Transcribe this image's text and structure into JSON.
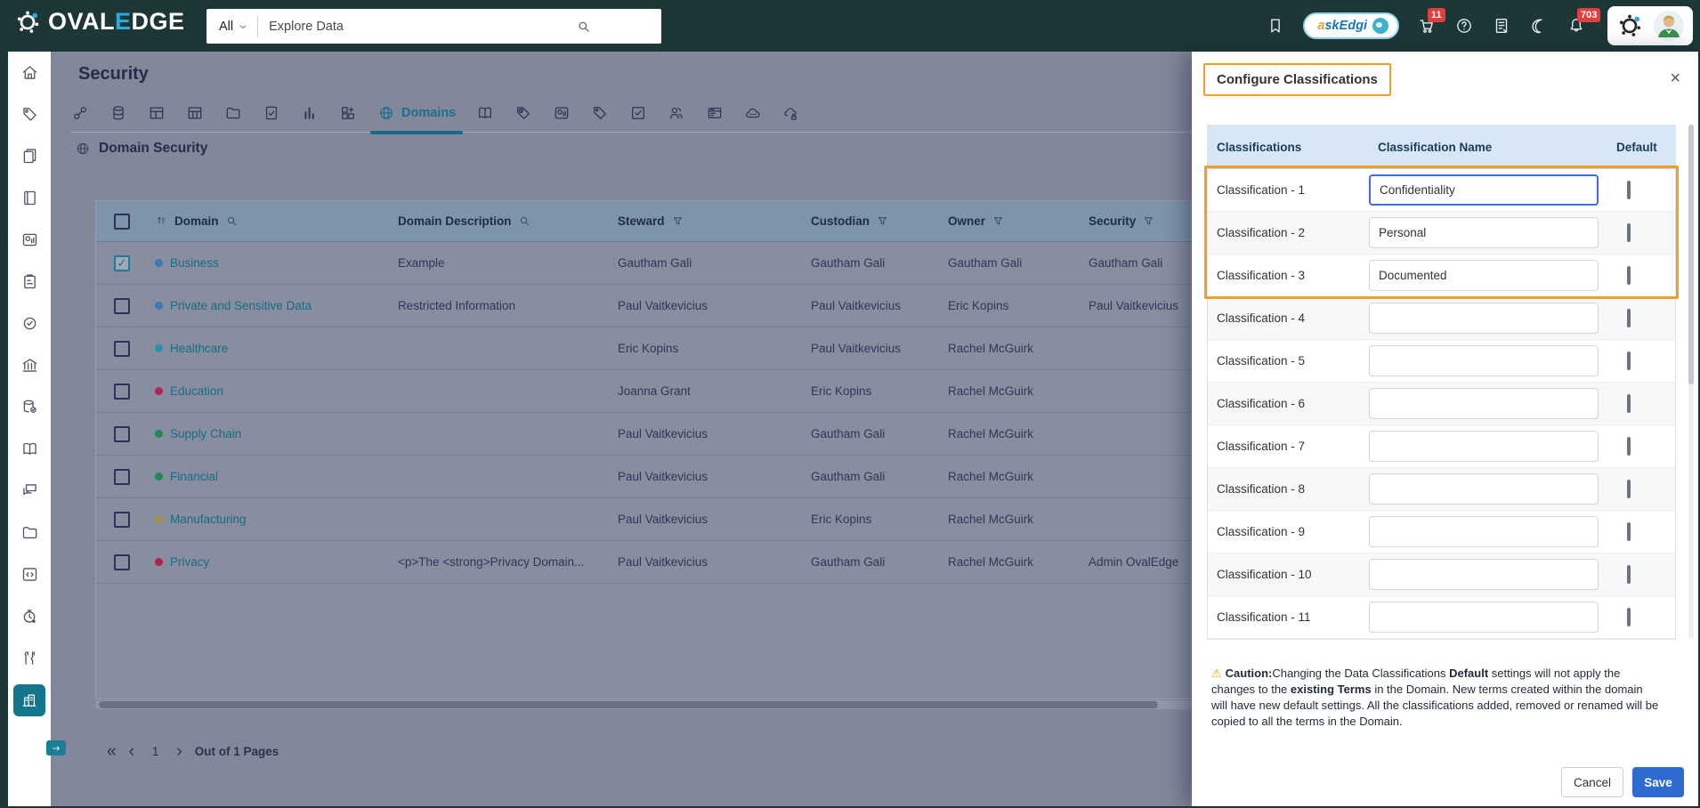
{
  "navbar": {
    "brand": {
      "part1": "OVAL",
      "accent": "E",
      "part2": "DGE"
    },
    "search": {
      "scope": "All",
      "placeholder": "Explore Data"
    },
    "askedgi": {
      "first": "a",
      "rest": "skEdgi"
    },
    "cart_badge": "11",
    "bell_badge": "703",
    "icons": [
      "bookmark-icon",
      "cart-icon",
      "help-icon",
      "release-notes-icon",
      "dark-mode-icon",
      "notifications-icon"
    ]
  },
  "sidebar": {
    "items": [
      {
        "name": "home",
        "icon": "home"
      },
      {
        "name": "tags",
        "icon": "tag"
      },
      {
        "name": "data-catalog",
        "icon": "pages"
      },
      {
        "name": "glossary",
        "icon": "book"
      },
      {
        "name": "reports",
        "icon": "report"
      },
      {
        "name": "projects",
        "icon": "clipboard"
      },
      {
        "name": "approvals",
        "icon": "badge-check"
      },
      {
        "name": "governance",
        "icon": "bank"
      },
      {
        "name": "data-stores",
        "icon": "database-check"
      },
      {
        "name": "literacy",
        "icon": "open-book"
      },
      {
        "name": "collaboration",
        "icon": "chat"
      },
      {
        "name": "files",
        "icon": "folder"
      },
      {
        "name": "query-sheets",
        "icon": "code"
      },
      {
        "name": "schedulers",
        "icon": "timer"
      },
      {
        "name": "tools",
        "icon": "tools"
      },
      {
        "name": "security",
        "icon": "building",
        "active": true
      }
    ]
  },
  "page": {
    "title": "Security",
    "section_title": "Domain Security",
    "tabs": [
      {
        "name": "connectors",
        "icon": "link"
      },
      {
        "name": "databases",
        "icon": "database"
      },
      {
        "name": "tables",
        "icon": "table"
      },
      {
        "name": "columns",
        "icon": "columns"
      },
      {
        "name": "files",
        "icon": "folder"
      },
      {
        "name": "queries",
        "icon": "file-check"
      },
      {
        "name": "charts",
        "icon": "bar-chart"
      },
      {
        "name": "data-models",
        "icon": "grid-plus"
      },
      {
        "name": "domains",
        "icon": "globe",
        "label": "Domains",
        "active": true
      },
      {
        "name": "glossary",
        "icon": "open-book"
      },
      {
        "name": "tags",
        "icon": "tag-clock"
      },
      {
        "name": "reports",
        "icon": "report"
      },
      {
        "name": "labels",
        "icon": "tag"
      },
      {
        "name": "certifications",
        "icon": "check-square"
      },
      {
        "name": "users",
        "icon": "users"
      },
      {
        "name": "service-desk",
        "icon": "card"
      },
      {
        "name": "apis",
        "icon": "cloud"
      },
      {
        "name": "api-security",
        "icon": "cloud-lock"
      }
    ]
  },
  "table": {
    "columns": [
      "Domain",
      "Domain Description",
      "Steward",
      "Custodian",
      "Owner",
      "Security"
    ],
    "rows": [
      {
        "name": "Business",
        "dot": "#3a7ab8",
        "checked": true,
        "description": "Example",
        "steward": "Gautham Gali",
        "custodian": "Gautham Gali",
        "owner": "Gautham Gali",
        "security": "Gautham Gali"
      },
      {
        "name": "Private and Sensitive Data",
        "dot": "#3a7ab8",
        "checked": false,
        "description": "Restricted Information",
        "steward": "Paul Vaitkevicius",
        "custodian": "Paul Vaitkevicius",
        "owner": "Eric Kopins",
        "security": "Paul Vaitkevicius"
      },
      {
        "name": "Healthcare",
        "dot": "#2a93a8",
        "checked": false,
        "description": "",
        "steward": "Eric Kopins",
        "custodian": "Paul Vaitkevicius",
        "owner": "Rachel McGuirk",
        "security": ""
      },
      {
        "name": "Education",
        "dot": "#b02458",
        "checked": false,
        "description": "",
        "steward": "Joanna Grant",
        "custodian": "Eric Kopins",
        "owner": "Rachel McGuirk",
        "security": ""
      },
      {
        "name": "Supply Chain",
        "dot": "#1f8a55",
        "checked": false,
        "description": "",
        "steward": "Paul Vaitkevicius",
        "custodian": "Gautham Gali",
        "owner": "Rachel McGuirk",
        "security": ""
      },
      {
        "name": "Financial",
        "dot": "#1f8a55",
        "checked": false,
        "description": "",
        "steward": "Paul Vaitkevicius",
        "custodian": "Gautham Gali",
        "owner": "Rachel McGuirk",
        "security": ""
      },
      {
        "name": "Manufacturing",
        "dot": "#a79150",
        "checked": false,
        "description": "",
        "steward": "Paul Vaitkevicius",
        "custodian": "Eric Kopins",
        "owner": "Rachel McGuirk",
        "security": ""
      },
      {
        "name": "Privacy",
        "dot": "#b02448",
        "checked": false,
        "description": "<p>The <strong>Privacy Domain...",
        "steward": "Paul Vaitkevicius",
        "custodian": "Gautham Gali",
        "owner": "Rachel McGuirk",
        "security": "Admin OvalEdge"
      }
    ],
    "pagination": {
      "first": "«",
      "prev": "‹",
      "page": "1",
      "next": "›",
      "label": "Out of 1 Pages"
    }
  },
  "panel": {
    "title": "Configure Classifications",
    "close": "×",
    "columns": [
      "Classifications",
      "Classification Name",
      "Default"
    ],
    "rows": [
      {
        "label": "Classification - 1",
        "value": "Confidentiality",
        "checked": false
      },
      {
        "label": "Classification - 2",
        "value": "Personal",
        "checked": false
      },
      {
        "label": "Classification - 3",
        "value": "Documented",
        "checked": false
      },
      {
        "label": "Classification - 4",
        "value": "",
        "checked": false
      },
      {
        "label": "Classification - 5",
        "value": "",
        "checked": false
      },
      {
        "label": "Classification - 6",
        "value": "",
        "checked": false
      },
      {
        "label": "Classification - 7",
        "value": "",
        "checked": false
      },
      {
        "label": "Classification - 8",
        "value": "",
        "checked": false
      },
      {
        "label": "Classification - 9",
        "value": "",
        "checked": false
      },
      {
        "label": "Classification - 10",
        "value": "",
        "checked": false
      },
      {
        "label": "Classification - 11",
        "value": "",
        "checked": false
      }
    ],
    "caution": {
      "warn": "⚠",
      "b0": "Caution:",
      "t1": "Changing the Data Classifications ",
      "b1": "Default",
      "t2": " settings will not apply the changes to the ",
      "b2": "existing Terms",
      "t3": " in the Domain. New terms created within the domain will have new default settings. All the classifications added, removed or renamed will be copied to all the terms in the Domain."
    },
    "buttons": {
      "cancel": "Cancel",
      "save": "Save"
    }
  },
  "colors": {
    "accent_teal": "#13768c",
    "highlight_orange": "#f0a028",
    "save_blue": "#2e6bd0",
    "badge_red": "#e43d3d",
    "navbar_bg": "#1d3737"
  }
}
